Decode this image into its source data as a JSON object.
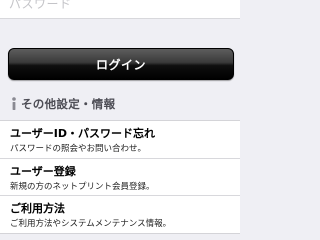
{
  "password_field": {
    "label": "パスワード"
  },
  "login_button": {
    "label": "ログイン"
  },
  "section": {
    "title": "その他設定・情報",
    "icon": "info-icon"
  },
  "menu": [
    {
      "title": "ユーザーID・パスワード忘れ",
      "description": "パスワードの照会やお問い合わせ。"
    },
    {
      "title": "ユーザー登録",
      "description": "新規の方のネットプリント会員登録。"
    },
    {
      "title": "ご利用方法",
      "description": "ご利用方法やシステムメンテナンス情報。"
    }
  ],
  "colors": {
    "background": "#efeff4",
    "button": "#000000",
    "button_text": "#ffffff",
    "section_text": "#4d4d55"
  }
}
